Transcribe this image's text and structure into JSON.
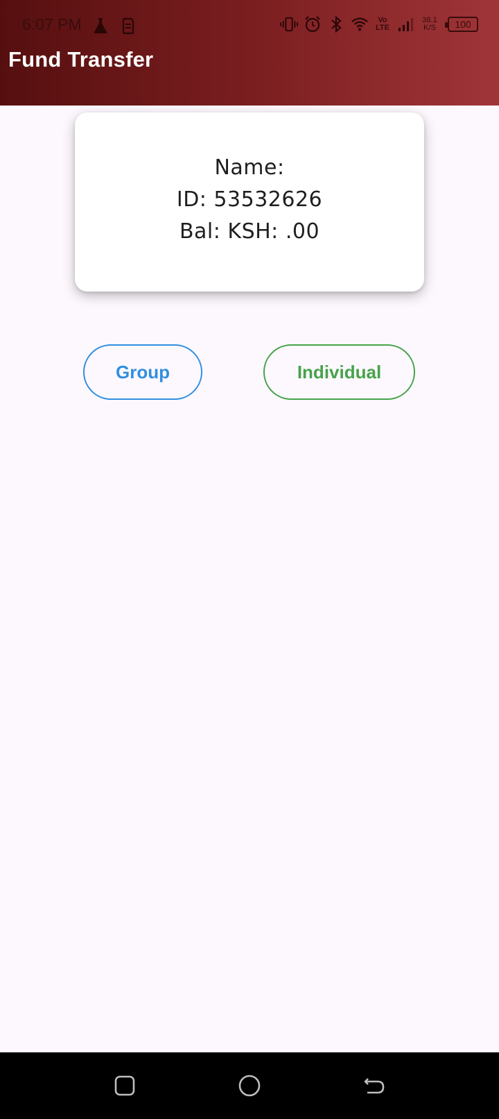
{
  "status_bar": {
    "time": "6:07 PM",
    "left_icons": [
      "flask-icon",
      "sim-icon"
    ],
    "right_icons": [
      "vibrate-icon",
      "alarm-icon",
      "bluetooth-icon",
      "wifi-icon",
      "volte-icon",
      "signal-icon"
    ],
    "volte_top": "Vo",
    "volte_bottom": "LTE",
    "net_speed_value": "38.1",
    "net_speed_unit": "K/S",
    "battery_level": "100"
  },
  "app_bar": {
    "title": "Fund Transfer"
  },
  "account_card": {
    "name_line": "Name:",
    "id_line": "ID: 53532626",
    "balance_line": "Bal: KSH: .00"
  },
  "actions": {
    "group_label": "Group",
    "individual_label": "Individual"
  },
  "nav_bar": {
    "buttons": [
      "recents-icon",
      "home-icon",
      "back-icon"
    ]
  },
  "colors": {
    "header_gradient_start": "#560f0f",
    "header_gradient_end": "#a03538",
    "group_accent": "#2f8fe0",
    "individual_accent": "#46a34a",
    "background": "#fdf8fd"
  }
}
